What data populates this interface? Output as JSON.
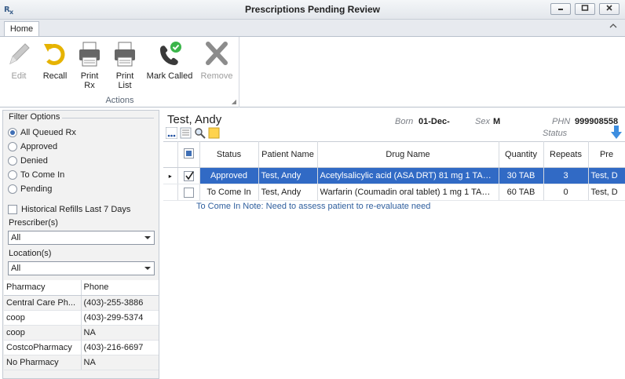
{
  "window": {
    "title": "Prescriptions Pending Review",
    "app_icon": "rx-icon",
    "controls": {
      "minimize": "minimize-icon",
      "maximize": "maximize-icon",
      "close": "close-icon"
    }
  },
  "ribbon": {
    "tabs": [
      {
        "label": "Home"
      }
    ],
    "group_label": "Actions",
    "buttons": {
      "edit": "Edit",
      "recall": "Recall",
      "print_rx_1": "Print",
      "print_rx_2": "Rx",
      "print_list_1": "Print",
      "print_list_2": "List",
      "mark_called": "Mark Called",
      "remove": "Remove"
    }
  },
  "filter": {
    "title": "Filter Options",
    "options": [
      "All Queued Rx",
      "Approved",
      "Denied",
      "To Come In",
      "Pending"
    ],
    "selected": "All Queued Rx",
    "historical_label": "Historical Refills Last 7 Days",
    "prescriber_label": "Prescriber(s)",
    "prescriber_value": "All",
    "location_label": "Location(s)",
    "location_value": "All"
  },
  "pharmacies": {
    "headers": [
      "Pharmacy",
      "Phone"
    ],
    "rows": [
      [
        "Central Care Ph...",
        "(403)-255-3886"
      ],
      [
        "coop",
        "(403)-299-5374"
      ],
      [
        "coop",
        "NA"
      ],
      [
        "CostcoPharmacy",
        "(403)-216-6697"
      ],
      [
        "No Pharmacy",
        "NA"
      ]
    ]
  },
  "patient": {
    "name": "Test, Andy",
    "born_label": "Born",
    "born_value": "01-Dec-",
    "sex_label": "Sex",
    "sex_value": "M",
    "phn_label": "PHN",
    "phn_value": "999908558",
    "status_label": "Status"
  },
  "grid": {
    "headers": [
      "Status",
      "Patient Name",
      "Drug Name",
      "Quantity",
      "Repeats",
      "Pre"
    ],
    "rows": [
      {
        "status": "Approved",
        "patient": "Test, Andy",
        "drug": "Acetylsalicylic acid (ASA DRT) 81 mg 1 TAB ...",
        "quantity": "30 TAB",
        "repeats": "3",
        "prescriber": "Test, D",
        "checked": true,
        "selected": true,
        "indicator": "▸"
      },
      {
        "status": "To Come In",
        "patient": "Test, Andy",
        "drug": "Warfarin (Coumadin oral tablet) 1 mg 1 TAB ...",
        "quantity": "60 TAB",
        "repeats": "0",
        "prescriber": "Test, D",
        "checked": false,
        "selected": false,
        "indicator": ""
      }
    ],
    "note": "To Come In Note: Need to assess patient to re-evaluate need"
  },
  "colors": {
    "selection": "#316ac5",
    "note_text": "#2f5f9e",
    "accent_green": "#3bb54a"
  }
}
